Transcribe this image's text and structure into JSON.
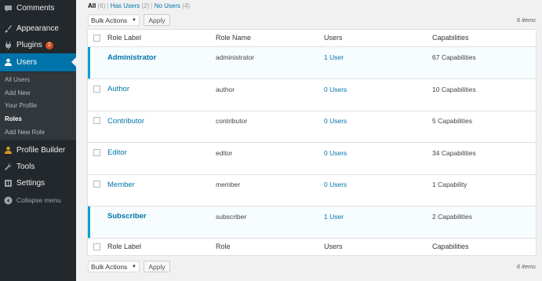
{
  "sidebar": {
    "comments": "Comments",
    "appearance": "Appearance",
    "plugins": "Plugins",
    "plugins_badge": "2",
    "users": "Users",
    "submenu": [
      "All Users",
      "Add New",
      "Your Profile",
      "Roles",
      "Add New Role"
    ],
    "profile_builder": "Profile Builder",
    "tools": "Tools",
    "settings": "Settings",
    "collapse": "Collapse menu"
  },
  "filters": {
    "all_label": "All",
    "all_count": "(6)",
    "has_users_label": "Has Users",
    "has_users_count": "(2)",
    "no_users_label": "No Users",
    "no_users_count": "(4)",
    "sep": "|"
  },
  "bulk": {
    "label": "Bulk Actions",
    "apply": "Apply",
    "items_count": "6 items"
  },
  "table": {
    "header": {
      "role_label": "Role Label",
      "role_name": "Role Name",
      "users": "Users",
      "capabilities": "Capabilities"
    },
    "footer": {
      "role_label": "Role Label",
      "role": "Role",
      "users": "Users",
      "capabilities": "Capabilities"
    },
    "rows": [
      {
        "label": "Administrator",
        "name": "administrator",
        "users": "1 User",
        "capabilities": "67 Capabilities"
      },
      {
        "label": "Author",
        "name": "author",
        "users": "0 Users",
        "capabilities": "10 Capabilities"
      },
      {
        "label": "Contributor",
        "name": "contributor",
        "users": "0 Users",
        "capabilities": "5 Capabilities"
      },
      {
        "label": "Editor",
        "name": "editor",
        "users": "0 Users",
        "capabilities": "34 Capabilities"
      },
      {
        "label": "Member",
        "name": "member",
        "users": "0 Users",
        "capabilities": "1 Capability"
      },
      {
        "label": "Subscriber",
        "name": "subscriber",
        "users": "1 User",
        "capabilities": "2 Capabilities"
      }
    ]
  },
  "colors": {
    "sidebar_bg": "#23282d",
    "active_bg": "#0073aa",
    "link": "#0073aa",
    "highlight_border": "#00a0d2"
  }
}
